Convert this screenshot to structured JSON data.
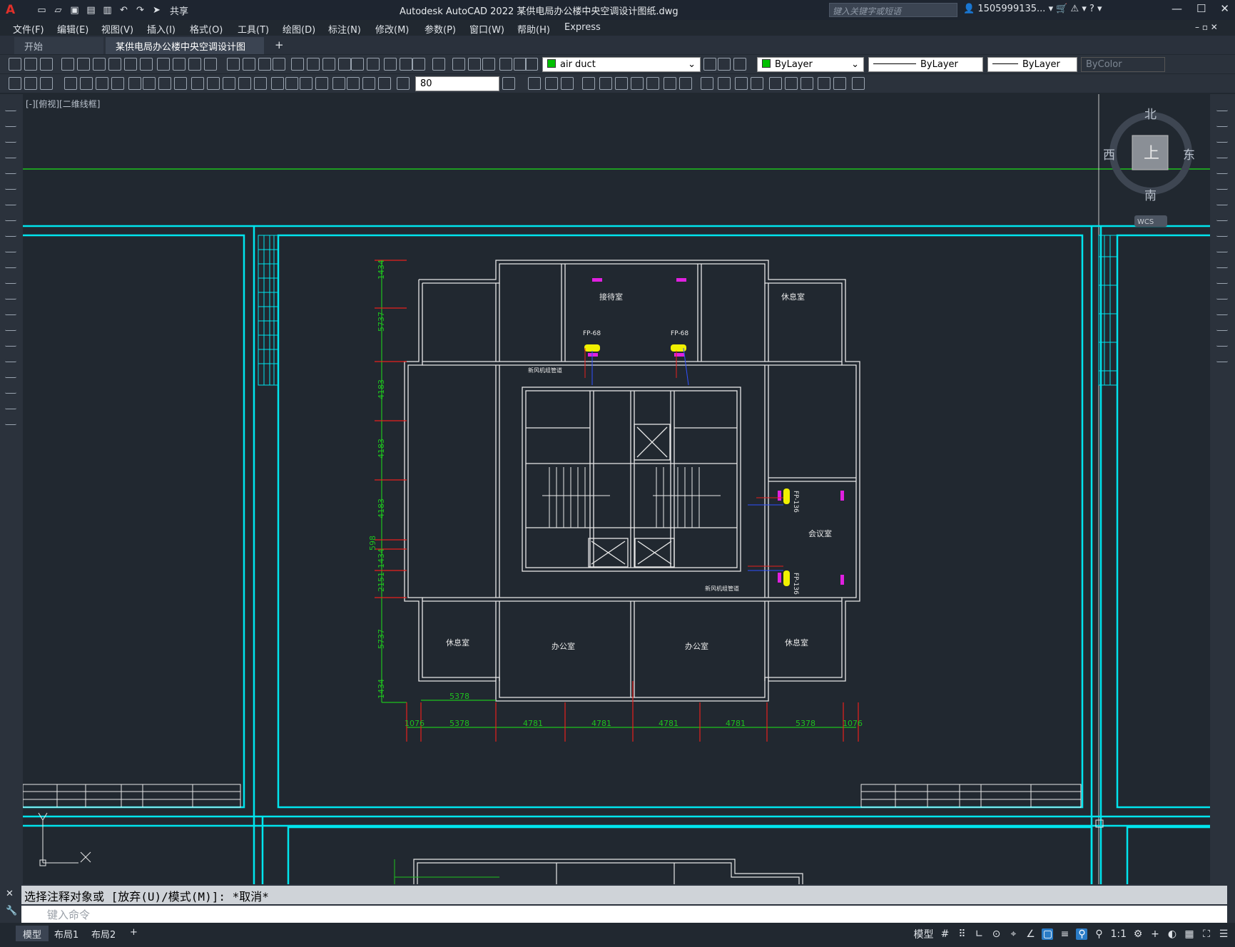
{
  "title_bar": {
    "logo": "A",
    "share_label": "共享",
    "window_title": "Autodesk AutoCAD 2022    某供电局办公楼中央空调设计图纸.dwg",
    "search_placeholder": "键入关键字或短语",
    "user": "1505999135..."
  },
  "menu": [
    "文件(F)",
    "编辑(E)",
    "视图(V)",
    "插入(I)",
    "格式(O)",
    "工具(T)",
    "绘图(D)",
    "标注(N)",
    "修改(M)",
    "参数(P)",
    "窗口(W)",
    "帮助(H)",
    "Express"
  ],
  "tabs": {
    "start": "开始",
    "active": "某供电局办公楼中央空调设计图纸*",
    "close": "✕",
    "add": "+"
  },
  "properties": {
    "layer": "air duct",
    "color": "ByLayer",
    "linetype": "ByLayer",
    "lineweight": "ByLayer",
    "plotstyle": "ByColor",
    "dimscale": "80"
  },
  "viewport_label": "[-][俯视][二维线框]",
  "viewcube": {
    "north": "北",
    "south": "南",
    "east": "东",
    "west": "西",
    "top": "上",
    "wcs": "WCS"
  },
  "drawing": {
    "rooms": [
      "接待室",
      "休息室",
      "休息室",
      "休息室",
      "办公室",
      "办公室",
      "会议室"
    ],
    "units": [
      "FP-68",
      "FP-68",
      "FP-136",
      "FP-136"
    ],
    "notes": [
      "新风机组管道",
      "新风机组管道"
    ],
    "vdims": [
      "1434",
      "5737",
      "4183",
      "4183",
      "4183",
      "598",
      "1434",
      "2151",
      "5737",
      "1434"
    ],
    "hdims": [
      "1076",
      "5378",
      "4781",
      "4781",
      "4781",
      "4781",
      "5378",
      "1076"
    ],
    "top_dim": "5378"
  },
  "command": {
    "history": "选择注释对象或 [放弃(U)/模式(M)]: *取消*",
    "placeholder": "键入命令"
  },
  "layout_tabs": [
    "模型",
    "布局1",
    "布局2",
    "+"
  ],
  "status": {
    "model": "模型",
    "scale": "1:1"
  },
  "colors": {
    "cyan": "#00e5ee",
    "green": "#1ec21e",
    "red": "#e8201c",
    "magenta": "#e020e0",
    "yellow": "#f0f000",
    "white": "#e8e8e8",
    "blue": "#3050ff"
  }
}
